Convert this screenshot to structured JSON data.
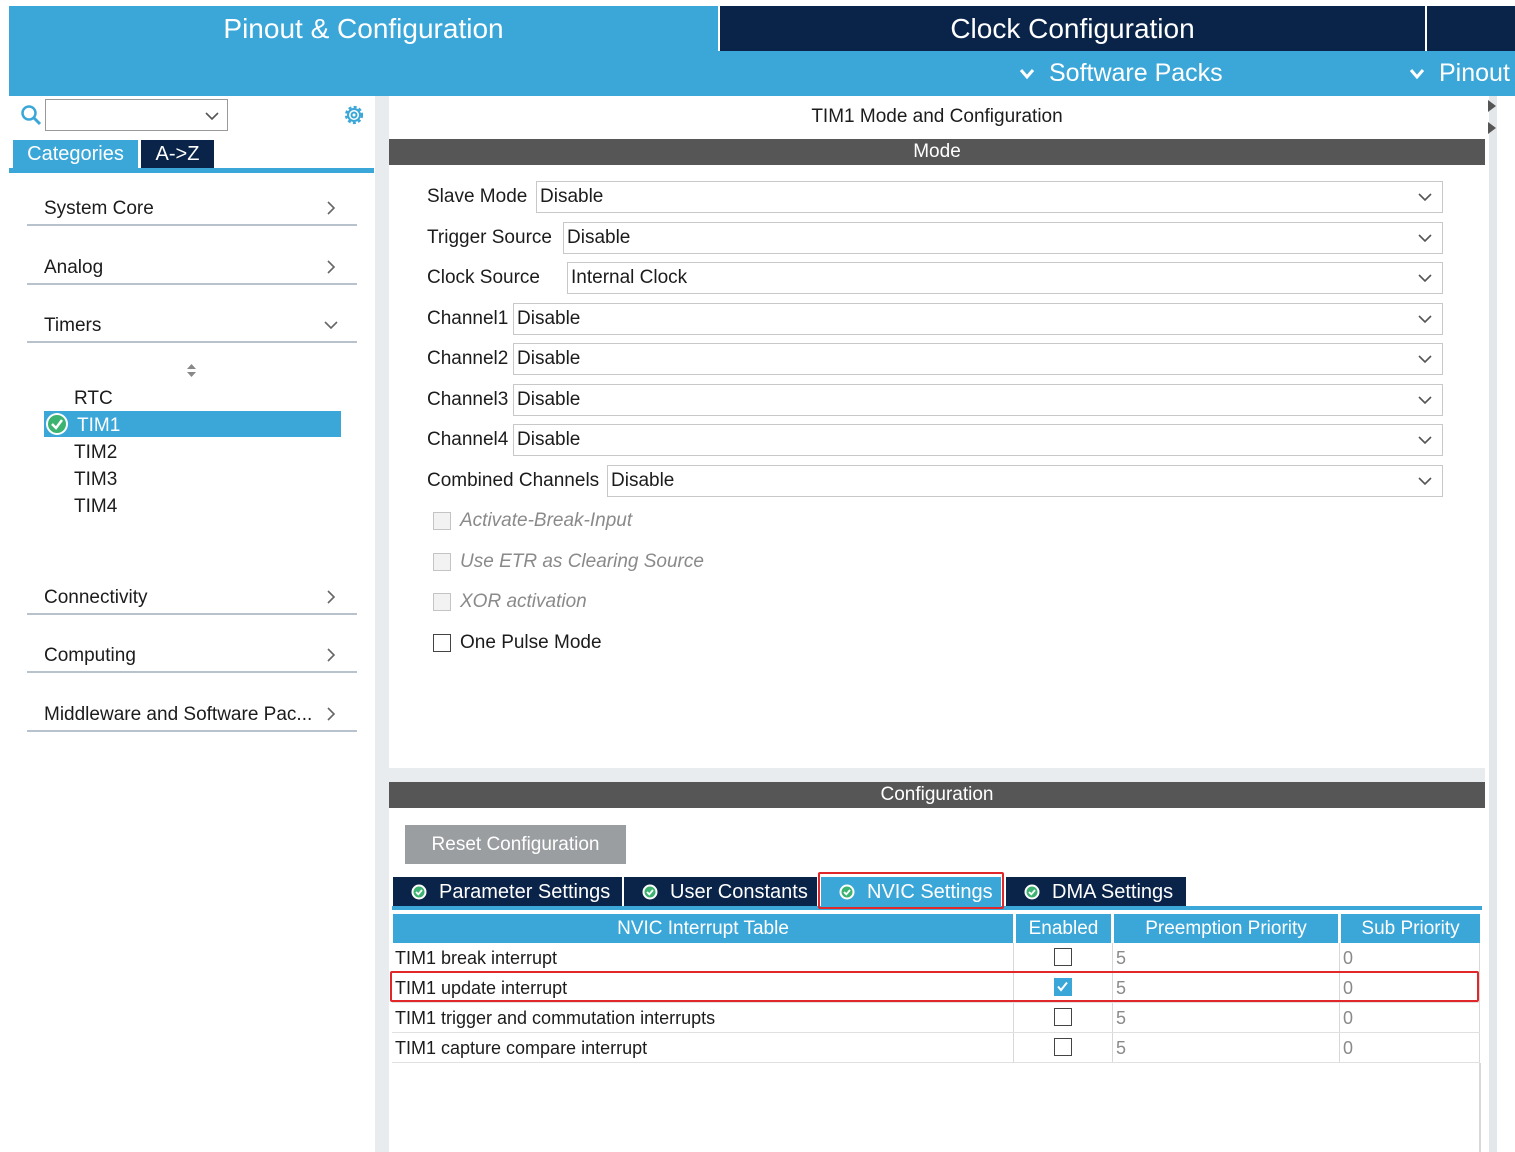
{
  "top_tabs": {
    "pinout": "Pinout & Configuration",
    "clock": "Clock Configuration"
  },
  "subbar": {
    "software_packs": "Software Packs",
    "pinout": "Pinout"
  },
  "left": {
    "search_value": "",
    "tabs": {
      "categories": "Categories",
      "az": "A->Z"
    },
    "categories": [
      {
        "label": "System Core"
      },
      {
        "label": "Analog"
      },
      {
        "label": "Timers"
      },
      {
        "label": "Connectivity"
      },
      {
        "label": "Computing"
      },
      {
        "label": "Middleware and Software Pac..."
      }
    ],
    "timers": [
      {
        "label": "RTC"
      },
      {
        "label": "TIM1",
        "selected": true
      },
      {
        "label": "TIM2"
      },
      {
        "label": "TIM3"
      },
      {
        "label": "TIM4"
      }
    ]
  },
  "main": {
    "title": "TIM1 Mode and Configuration",
    "mode_header": "Mode",
    "fields": [
      {
        "label": "Slave Mode",
        "value": "Disable"
      },
      {
        "label": "Trigger Source",
        "value": "Disable"
      },
      {
        "label": "Clock Source",
        "value": "Internal Clock"
      },
      {
        "label": "Channel1",
        "value": "Disable"
      },
      {
        "label": "Channel2",
        "value": "Disable"
      },
      {
        "label": "Channel3",
        "value": "Disable"
      },
      {
        "label": "Channel4",
        "value": "Disable"
      },
      {
        "label": "Combined Channels",
        "value": "Disable"
      }
    ],
    "checkboxes": [
      {
        "label": "Activate-Break-Input",
        "disabled": true,
        "checked": false
      },
      {
        "label": "Use ETR as Clearing Source",
        "disabled": true,
        "checked": false
      },
      {
        "label": "XOR activation",
        "disabled": true,
        "checked": false
      },
      {
        "label": "One Pulse Mode",
        "disabled": false,
        "checked": false
      }
    ],
    "config_header": "Configuration",
    "reset_button": "Reset Configuration",
    "config_tabs": [
      {
        "label": "Parameter Settings",
        "active": false
      },
      {
        "label": "User Constants",
        "active": false
      },
      {
        "label": "NVIC Settings",
        "active": true
      },
      {
        "label": "DMA Settings",
        "active": false
      }
    ],
    "nvic_table": {
      "headers": [
        "NVIC Interrupt Table",
        "Enabled",
        "Preemption Priority",
        "Sub Priority"
      ],
      "rows": [
        {
          "name": "TIM1 break interrupt",
          "enabled": false,
          "preemption": "5",
          "sub": "0"
        },
        {
          "name": "TIM1 update interrupt",
          "enabled": true,
          "preemption": "5",
          "sub": "0"
        },
        {
          "name": "TIM1 trigger and commutation interrupts",
          "enabled": false,
          "preemption": "5",
          "sub": "0"
        },
        {
          "name": "TIM1 capture compare interrupt",
          "enabled": false,
          "preemption": "5",
          "sub": "0"
        }
      ]
    }
  },
  "colors": {
    "accent_blue": "#3ba7d9",
    "navy": "#0a2349",
    "dark_header": "#565656",
    "highlight_red": "#e2272b",
    "ok_green": "#3cb371"
  }
}
